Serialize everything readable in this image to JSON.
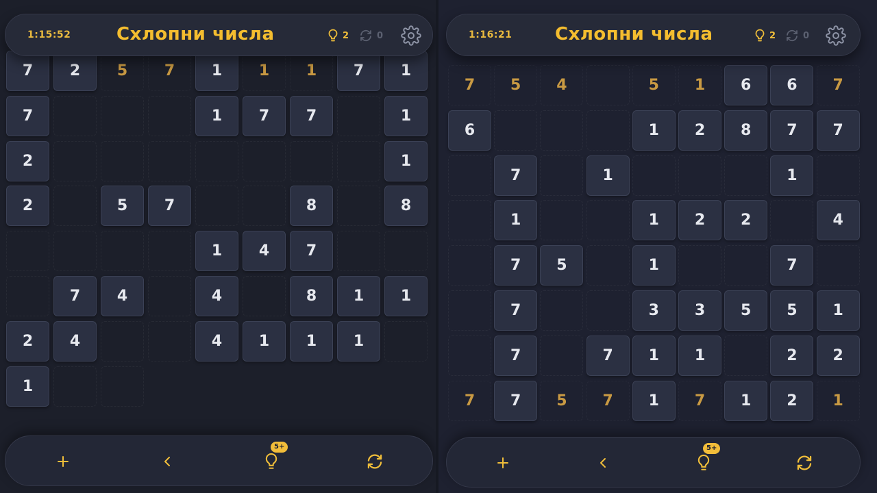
{
  "colors": {
    "accent": "#f4bd2f",
    "tile": "#2b3042",
    "used_number": "#c99a43",
    "background": "#1c1f2a"
  },
  "panels": [
    {
      "id": "left",
      "header": {
        "timer": "1:15:52",
        "title": "Схлопни числа",
        "hints": "2",
        "shuffles": "0",
        "hint_icon": "lightbulb-icon",
        "shuffle_icon": "refresh-icon",
        "settings_icon": "gear-icon"
      },
      "grid": [
        [
          {
            "v": "7",
            "s": "tile"
          },
          {
            "v": "2",
            "s": "tile"
          },
          {
            "v": "5",
            "s": "used"
          },
          {
            "v": "7",
            "s": "used"
          },
          {
            "v": "1",
            "s": "tile"
          },
          {
            "v": "1",
            "s": "used"
          },
          {
            "v": "1",
            "s": "used"
          },
          {
            "v": "7",
            "s": "tile"
          },
          {
            "v": "1",
            "s": "tile"
          }
        ],
        [
          {
            "v": "7",
            "s": "tile"
          },
          {
            "v": "",
            "s": "empty"
          },
          {
            "v": "",
            "s": "empty"
          },
          {
            "v": "",
            "s": "empty"
          },
          {
            "v": "1",
            "s": "tile"
          },
          {
            "v": "7",
            "s": "tile"
          },
          {
            "v": "7",
            "s": "tile"
          },
          {
            "v": "",
            "s": "empty"
          },
          {
            "v": "1",
            "s": "tile"
          }
        ],
        [
          {
            "v": "2",
            "s": "tile"
          },
          {
            "v": "",
            "s": "empty"
          },
          {
            "v": "",
            "s": "empty"
          },
          {
            "v": "",
            "s": "empty"
          },
          {
            "v": "",
            "s": "empty"
          },
          {
            "v": "",
            "s": "empty"
          },
          {
            "v": "",
            "s": "empty"
          },
          {
            "v": "",
            "s": "empty"
          },
          {
            "v": "1",
            "s": "tile"
          }
        ],
        [
          {
            "v": "2",
            "s": "tile"
          },
          {
            "v": "",
            "s": "empty"
          },
          {
            "v": "5",
            "s": "tile"
          },
          {
            "v": "7",
            "s": "tile"
          },
          {
            "v": "",
            "s": "empty"
          },
          {
            "v": "",
            "s": "empty"
          },
          {
            "v": "8",
            "s": "tile"
          },
          {
            "v": "",
            "s": "empty"
          },
          {
            "v": "8",
            "s": "tile"
          }
        ],
        [
          {
            "v": "",
            "s": "empty"
          },
          {
            "v": "",
            "s": "empty"
          },
          {
            "v": "",
            "s": "empty"
          },
          {
            "v": "",
            "s": "empty"
          },
          {
            "v": "1",
            "s": "tile"
          },
          {
            "v": "4",
            "s": "tile"
          },
          {
            "v": "7",
            "s": "tile"
          },
          {
            "v": "",
            "s": "empty"
          },
          {
            "v": "",
            "s": "empty"
          }
        ],
        [
          {
            "v": "",
            "s": "empty"
          },
          {
            "v": "7",
            "s": "tile"
          },
          {
            "v": "4",
            "s": "tile"
          },
          {
            "v": "",
            "s": "empty"
          },
          {
            "v": "4",
            "s": "tile"
          },
          {
            "v": "",
            "s": "empty"
          },
          {
            "v": "8",
            "s": "tile"
          },
          {
            "v": "1",
            "s": "tile"
          },
          {
            "v": "1",
            "s": "tile"
          }
        ],
        [
          {
            "v": "2",
            "s": "tile"
          },
          {
            "v": "4",
            "s": "tile"
          },
          {
            "v": "",
            "s": "empty"
          },
          {
            "v": "",
            "s": "empty"
          },
          {
            "v": "4",
            "s": "tile"
          },
          {
            "v": "1",
            "s": "tile"
          },
          {
            "v": "1",
            "s": "tile"
          },
          {
            "v": "1",
            "s": "tile"
          },
          {
            "v": "",
            "s": "empty"
          }
        ],
        [
          {
            "v": "1",
            "s": "tile"
          },
          {
            "v": "",
            "s": "empty"
          },
          {
            "v": "",
            "s": "empty"
          }
        ]
      ],
      "bottom_bar": {
        "add_icon": "plus-icon",
        "undo_icon": "chevron-left-icon",
        "hint_icon": "lightbulb-icon",
        "hint_badge": "5+",
        "shuffle_icon": "refresh-icon"
      }
    },
    {
      "id": "right",
      "header": {
        "timer": "1:16:21",
        "title": "Схлопни числа",
        "hints": "2",
        "shuffles": "0",
        "hint_icon": "lightbulb-icon",
        "shuffle_icon": "refresh-icon",
        "settings_icon": "gear-icon"
      },
      "grid": [
        [
          {
            "v": "7",
            "s": "used"
          },
          {
            "v": "5",
            "s": "used"
          },
          {
            "v": "4",
            "s": "used"
          },
          {
            "v": "",
            "s": "empty"
          },
          {
            "v": "5",
            "s": "used"
          },
          {
            "v": "1",
            "s": "used"
          },
          {
            "v": "6",
            "s": "tile"
          },
          {
            "v": "6",
            "s": "tile"
          },
          {
            "v": "7",
            "s": "used"
          }
        ],
        [
          {
            "v": "6",
            "s": "tile"
          },
          {
            "v": "",
            "s": "empty"
          },
          {
            "v": "",
            "s": "empty"
          },
          {
            "v": "",
            "s": "empty"
          },
          {
            "v": "1",
            "s": "tile"
          },
          {
            "v": "2",
            "s": "tile"
          },
          {
            "v": "8",
            "s": "tile"
          },
          {
            "v": "7",
            "s": "tile"
          },
          {
            "v": "7",
            "s": "tile"
          }
        ],
        [
          {
            "v": "",
            "s": "empty"
          },
          {
            "v": "7",
            "s": "tile"
          },
          {
            "v": "",
            "s": "empty"
          },
          {
            "v": "1",
            "s": "tile"
          },
          {
            "v": "",
            "s": "empty"
          },
          {
            "v": "",
            "s": "empty"
          },
          {
            "v": "",
            "s": "empty"
          },
          {
            "v": "1",
            "s": "tile"
          },
          {
            "v": "",
            "s": "empty"
          }
        ],
        [
          {
            "v": "",
            "s": "empty"
          },
          {
            "v": "1",
            "s": "tile"
          },
          {
            "v": "",
            "s": "empty"
          },
          {
            "v": "",
            "s": "empty"
          },
          {
            "v": "1",
            "s": "tile"
          },
          {
            "v": "2",
            "s": "tile"
          },
          {
            "v": "2",
            "s": "tile"
          },
          {
            "v": "",
            "s": "empty"
          },
          {
            "v": "4",
            "s": "tile"
          }
        ],
        [
          {
            "v": "",
            "s": "empty"
          },
          {
            "v": "7",
            "s": "tile"
          },
          {
            "v": "5",
            "s": "tile"
          },
          {
            "v": "",
            "s": "empty"
          },
          {
            "v": "1",
            "s": "tile"
          },
          {
            "v": "",
            "s": "empty"
          },
          {
            "v": "",
            "s": "empty"
          },
          {
            "v": "7",
            "s": "tile"
          },
          {
            "v": "",
            "s": "empty"
          }
        ],
        [
          {
            "v": "",
            "s": "empty"
          },
          {
            "v": "7",
            "s": "tile"
          },
          {
            "v": "",
            "s": "empty"
          },
          {
            "v": "",
            "s": "empty"
          },
          {
            "v": "3",
            "s": "tile"
          },
          {
            "v": "3",
            "s": "tile"
          },
          {
            "v": "5",
            "s": "tile"
          },
          {
            "v": "5",
            "s": "tile"
          },
          {
            "v": "1",
            "s": "tile"
          }
        ],
        [
          {
            "v": "",
            "s": "empty"
          },
          {
            "v": "7",
            "s": "tile"
          },
          {
            "v": "",
            "s": "empty"
          },
          {
            "v": "7",
            "s": "tile"
          },
          {
            "v": "1",
            "s": "tile"
          },
          {
            "v": "1",
            "s": "tile"
          },
          {
            "v": "",
            "s": "empty"
          },
          {
            "v": "2",
            "s": "tile"
          },
          {
            "v": "2",
            "s": "tile"
          }
        ],
        [
          {
            "v": "7",
            "s": "used"
          },
          {
            "v": "7",
            "s": "tile"
          },
          {
            "v": "5",
            "s": "used"
          },
          {
            "v": "7",
            "s": "used"
          },
          {
            "v": "1",
            "s": "tile"
          },
          {
            "v": "7",
            "s": "used"
          },
          {
            "v": "1",
            "s": "tile"
          },
          {
            "v": "2",
            "s": "tile"
          },
          {
            "v": "1",
            "s": "used"
          }
        ]
      ],
      "bottom_bar": {
        "add_icon": "plus-icon",
        "undo_icon": "chevron-left-icon",
        "hint_icon": "lightbulb-icon",
        "hint_badge": "5+",
        "shuffle_icon": "refresh-icon"
      }
    }
  ]
}
